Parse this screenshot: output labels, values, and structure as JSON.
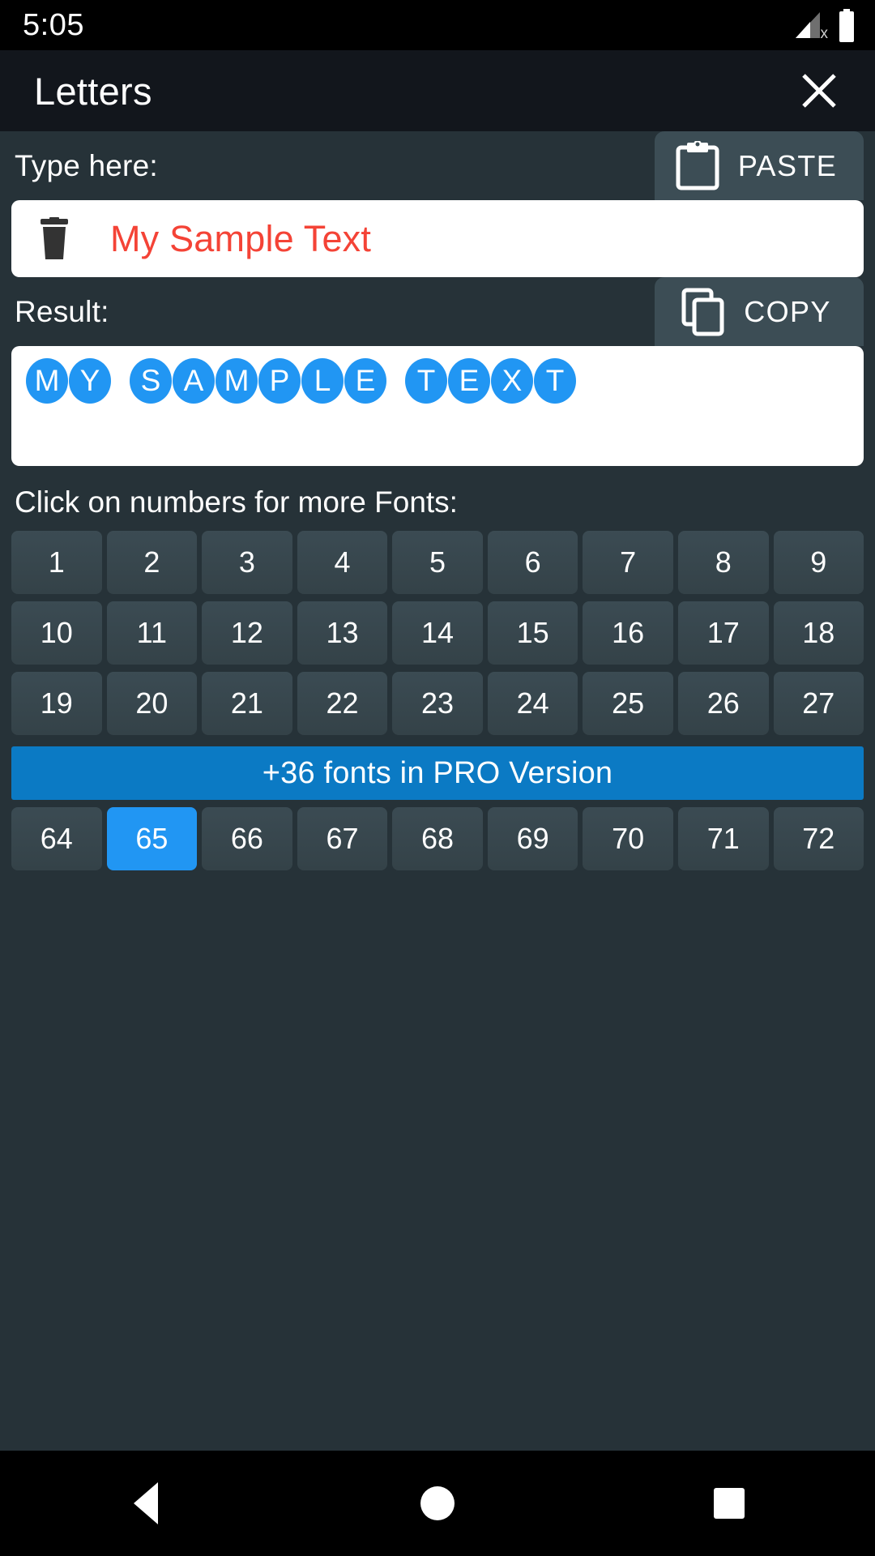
{
  "status_bar": {
    "time": "5:05",
    "signal_icon": "cellular-signal-no-service-icon",
    "signal_badge": "x",
    "battery_icon": "battery-full-icon"
  },
  "title_bar": {
    "title": "Letters",
    "close_icon": "close-icon"
  },
  "input_section": {
    "label": "Type here:",
    "paste_button": {
      "label": "PASTE",
      "icon": "clipboard-icon"
    },
    "clear_icon": "trash-icon",
    "value": "My Sample Text",
    "value_color": "#f44336"
  },
  "result_section": {
    "label": "Result:",
    "copy_button": {
      "label": "COPY",
      "icon": "copy-icon"
    },
    "text": "MY SAMPLE TEXT",
    "bubbles": [
      "M",
      "Y",
      " ",
      "S",
      "A",
      "M",
      "P",
      "L",
      "E",
      " ",
      "T",
      "E",
      "X",
      "T"
    ],
    "bubble_color": "#2196f3"
  },
  "font_grid": {
    "label": "Click on numbers for more Fonts:",
    "rows": [
      [
        "1",
        "2",
        "3",
        "4",
        "5",
        "6",
        "7",
        "8",
        "9"
      ],
      [
        "10",
        "11",
        "12",
        "13",
        "14",
        "15",
        "16",
        "17",
        "18"
      ],
      [
        "19",
        "20",
        "21",
        "22",
        "23",
        "24",
        "25",
        "26",
        "27"
      ]
    ],
    "pro_banner": "+36 fonts in PRO Version",
    "bottom_row": [
      "64",
      "65",
      "66",
      "67",
      "68",
      "69",
      "70",
      "71",
      "72"
    ],
    "selected": "65",
    "selected_color": "#2196f3"
  },
  "nav_bar": {
    "back": "back-icon",
    "home": "home-icon",
    "recents": "recents-icon"
  },
  "theme": {
    "background": "#263238",
    "title_bar": "#12161c",
    "button": "#3c4d55",
    "accent": "#2196f3",
    "pro_blue": "#0b7ac4"
  }
}
